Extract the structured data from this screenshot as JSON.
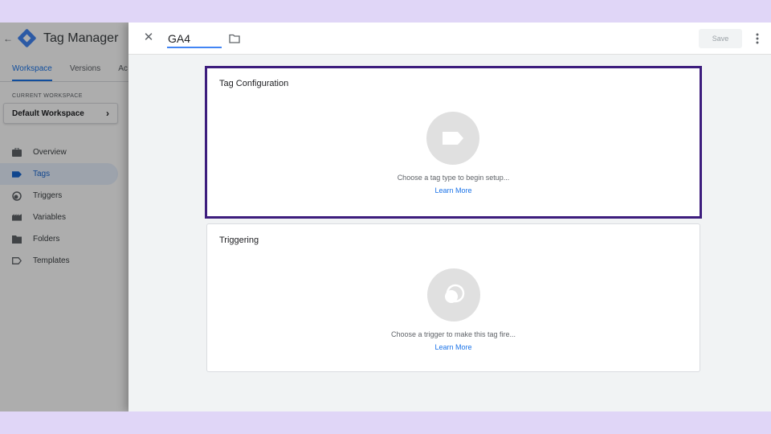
{
  "sidebar": {
    "title": "Tag Manager",
    "tabs": [
      {
        "label": "Workspace"
      },
      {
        "label": "Versions"
      },
      {
        "label": "Ac"
      }
    ],
    "workspace_section_label": "CURRENT WORKSPACE",
    "workspace_name": "Default Workspace",
    "nav": [
      {
        "label": "Overview",
        "icon": "briefcase-icon"
      },
      {
        "label": "Tags",
        "icon": "tag-icon"
      },
      {
        "label": "Triggers",
        "icon": "trigger-icon"
      },
      {
        "label": "Variables",
        "icon": "variables-icon"
      },
      {
        "label": "Folders",
        "icon": "folder-icon"
      },
      {
        "label": "Templates",
        "icon": "template-icon"
      }
    ],
    "active_nav": "Tags"
  },
  "editor": {
    "tag_name": "GA4",
    "save_label": "Save",
    "tag_configuration": {
      "title": "Tag Configuration",
      "hint": "Choose a tag type to begin setup...",
      "link": "Learn More"
    },
    "triggering": {
      "title": "Triggering",
      "hint": "Choose a trigger to make this tag fire...",
      "link": "Learn More"
    }
  },
  "colors": {
    "background": "#e0d6f7",
    "accent": "#1a73e8",
    "highlight_border": "#3d1d7d"
  }
}
